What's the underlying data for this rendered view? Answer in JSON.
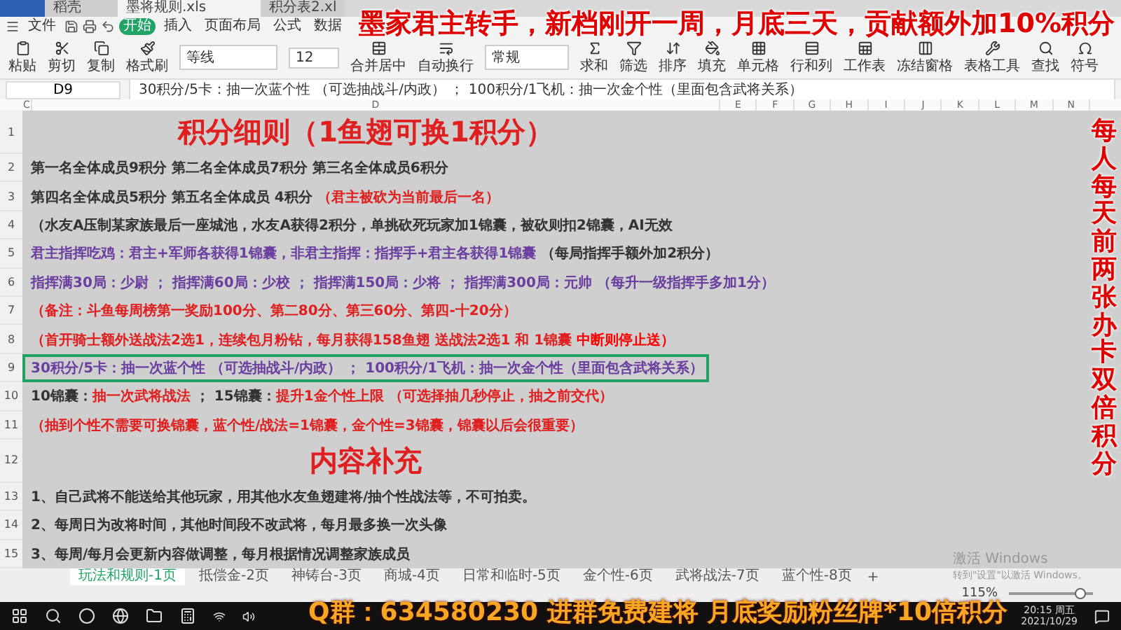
{
  "headline_overlay": "墨家君主转手，新档刚开一周，月底三天，贡献额外加10%积分",
  "side_overlay": "每人每天前两张办卡双倍积分",
  "bottom_overlay": "Q群：634580230 进群免费建将 月底奖励粉丝牌*10倍积分",
  "doc_tabs": [
    {
      "label": "稻壳",
      "selected": false
    },
    {
      "label": "墨将规则.xls",
      "selected": true
    },
    {
      "label": "积分表2.xl",
      "selected": false
    }
  ],
  "menu": [
    {
      "label": "文件",
      "selected": false
    },
    {
      "label": "开始",
      "selected": true
    },
    {
      "label": "插入",
      "selected": false
    },
    {
      "label": "页面布局",
      "selected": false
    },
    {
      "label": "公式",
      "selected": false
    },
    {
      "label": "数据",
      "selected": false
    }
  ],
  "ribbon": {
    "font": "等线",
    "size": "12",
    "number_format": "常规",
    "tools": [
      "粘贴",
      "剪切",
      "复制",
      "格式刷",
      "合并居中",
      "自动换行",
      "求和",
      "筛选",
      "排序",
      "填充",
      "单元格",
      "行和列",
      "工作表",
      "冻结窗格",
      "表格工具",
      "查找",
      "符号"
    ]
  },
  "formula_bar": {
    "cell": "D9",
    "formula": "30积分/5卡：抽一次蓝个性 （可选抽战斗/内政）  ；  100积分/1飞机：抽一次金个性（里面包含武将关系）"
  },
  "columns": [
    "C",
    "D",
    "E",
    "F",
    "G",
    "H",
    "I",
    "J",
    "K",
    "L",
    "M",
    "N"
  ],
  "rows": [
    {
      "number": "1",
      "kind": "title",
      "selected": false,
      "segments": [
        {
          "text": "积分细则（1鱼翅可换1积分）",
          "color": "#e02020"
        }
      ]
    },
    {
      "number": "2",
      "kind": "text",
      "selected": false,
      "segments": [
        {
          "text": "第一名全体成员9积分   第二名全体成员7积分  第三名全体成员6积分",
          "color": "#333333"
        }
      ]
    },
    {
      "number": "3",
      "kind": "text",
      "selected": false,
      "segments": [
        {
          "text": "第四名全体成员5积分  第五名全体成员 4积分  ",
          "color": "#333333"
        },
        {
          "text": "（君主被砍为当前最后一名）",
          "color": "#e02020"
        }
      ]
    },
    {
      "number": "4",
      "kind": "text",
      "selected": false,
      "segments": [
        {
          "text": "（水友A压制某家族最后一座城池，水友A获得2积分，单挑砍死玩家加1锦囊，被砍则扣2锦囊，AI无效",
          "color": "#333333"
        }
      ]
    },
    {
      "number": "5",
      "kind": "text",
      "selected": false,
      "segments": [
        {
          "text": "君主指挥吃鸡：君主+军师各获得1锦囊，非君主指挥：指挥手+君主各获得1锦囊 ",
          "color": "#6a3fa0"
        },
        {
          "text": "（每局指挥手额外加2积分）",
          "color": "#333333"
        }
      ]
    },
    {
      "number": "6",
      "kind": "text",
      "selected": false,
      "segments": [
        {
          "text": "指挥满30局：少尉 ； 指挥满60局：少校 ； 指挥满150局：少将 ； 指挥满300局：元帅 （每升一级指挥手多加1分）",
          "color": "#6a3fa0"
        }
      ]
    },
    {
      "number": "7",
      "kind": "text",
      "selected": false,
      "segments": [
        {
          "text": "（备注：斗鱼每周榜第一奖励100分、第二80分、第三60分、第四-十20分）",
          "color": "#e02020"
        }
      ]
    },
    {
      "number": "8",
      "kind": "text",
      "selected": false,
      "segments": [
        {
          "text": "（首开骑士额外送战法2选1，连续包月粉钻，每月获得158鱼翅 送战法2选1 和 1锦囊 ",
          "color": "#e02020"
        },
        {
          "text": "中断则停止送）",
          "color": "#ff0000"
        }
      ]
    },
    {
      "number": "9",
      "kind": "text",
      "selected": true,
      "segments": [
        {
          "text": "30积分/5卡：抽一次蓝个性 （可选抽战斗/内政）  ；  100积分/1飞机：抽一次金个性（里面包含武将关系）",
          "color": "#6a3fa0"
        }
      ]
    },
    {
      "number": "10",
      "kind": "text",
      "selected": false,
      "segments": [
        {
          "text": "10锦囊：",
          "color": "#333333"
        },
        {
          "text": "抽一次武将战法",
          "color": "#e02020"
        },
        {
          "text": " ； 15锦囊：",
          "color": "#333333"
        },
        {
          "text": "提升1金个性上限  （可选择抽几秒停止，抽之前交代）",
          "color": "#e02020"
        }
      ]
    },
    {
      "number": "11",
      "kind": "text",
      "selected": false,
      "segments": [
        {
          "text": "（抽到个性不需要可换锦囊，蓝个性/战法=1锦囊，金个性=3锦囊，锦囊以后会很重要）",
          "color": "#e02020"
        }
      ]
    },
    {
      "number": "12",
      "kind": "title",
      "selected": false,
      "segments": [
        {
          "text": "内容补充",
          "color": "#e02020"
        }
      ]
    },
    {
      "number": "13",
      "kind": "text",
      "selected": false,
      "segments": [
        {
          "text": "1、自己武将不能送给其他玩家，用其他水友鱼翅建将/抽个性战法等，不可拍卖。",
          "color": "#333333"
        }
      ]
    },
    {
      "number": "14",
      "kind": "text",
      "selected": false,
      "segments": [
        {
          "text": "2、每周日为改将时间，其他时间段不改武将，每月最多换一次头像",
          "color": "#333333"
        }
      ]
    },
    {
      "number": "15",
      "kind": "text",
      "selected": false,
      "segments": [
        {
          "text": "3、每周/每月会更新内容做调整，每月根据情况调整家族成员",
          "color": "#333333"
        }
      ]
    }
  ],
  "sheet_tabs": [
    {
      "label": "玩法和规则-1页",
      "selected": true
    },
    {
      "label": "抵偿金-2页",
      "selected": false
    },
    {
      "label": "神铸台-3页",
      "selected": false
    },
    {
      "label": "商城-4页",
      "selected": false
    },
    {
      "label": "日常和临时-5页",
      "selected": false
    },
    {
      "label": "金个性-6页",
      "selected": false
    },
    {
      "label": "武将战法-7页",
      "selected": false
    },
    {
      "label": "蓝个性-8页",
      "selected": false
    }
  ],
  "watermark": {
    "title": "激活 Windows",
    "hint": "转到\"设置\"以激活 Windows。"
  },
  "status_bar": {
    "zoom": "115%",
    "zoom_slider": {
      "level": 0.85
    }
  },
  "taskbar": {
    "time": "20:15 周五",
    "date": "2021/10/29"
  }
}
